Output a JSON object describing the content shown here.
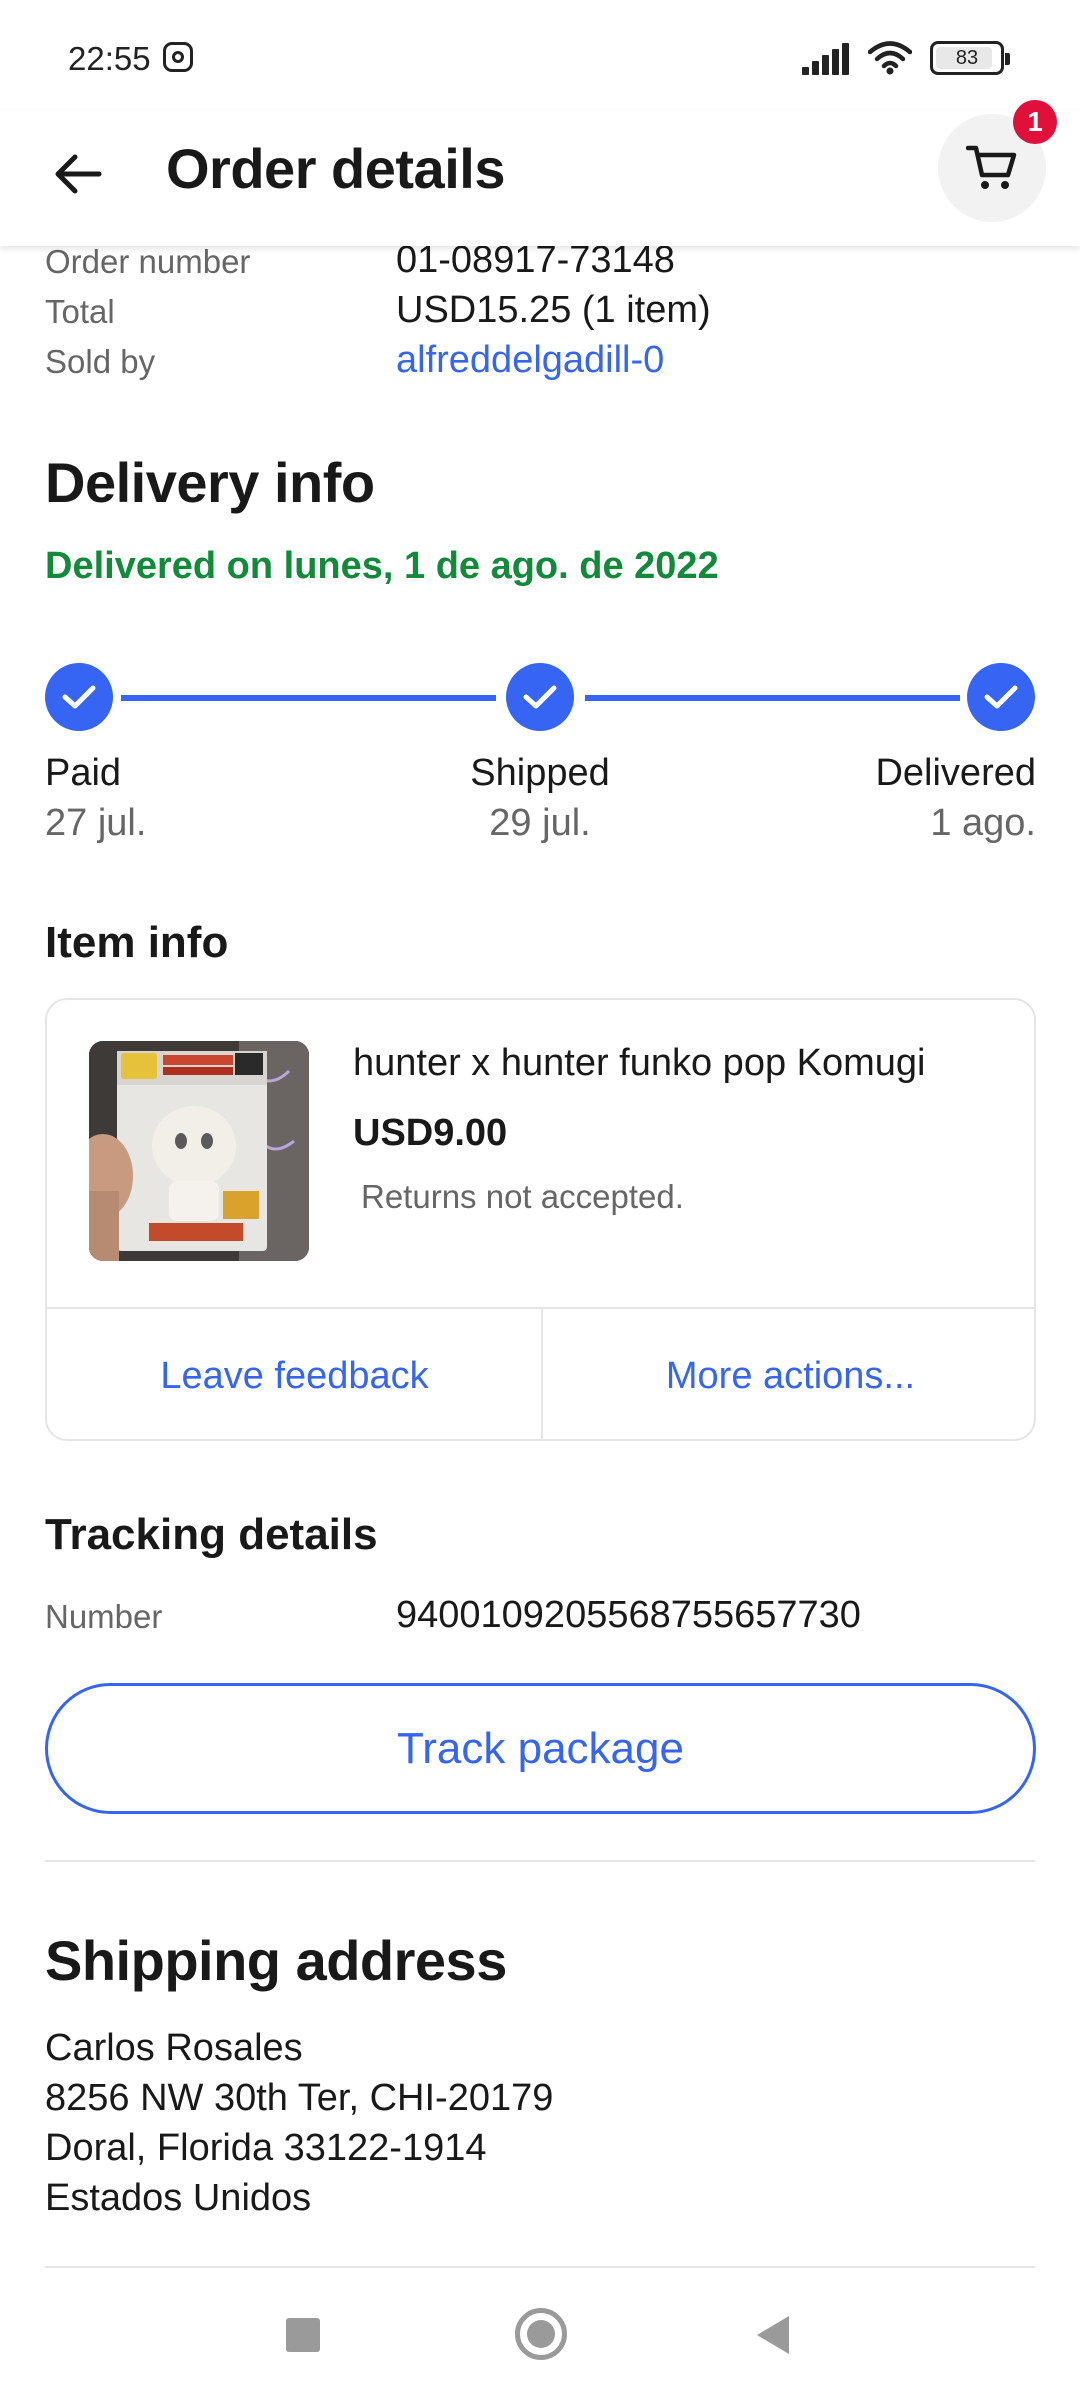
{
  "status_bar": {
    "time": "22:55",
    "battery": "83",
    "icons": [
      "instagram-icon",
      "signal-icon",
      "wifi-icon",
      "battery-icon"
    ]
  },
  "app_bar": {
    "title": "Order details",
    "back_icon": "arrow-left-icon",
    "cart_icon": "cart-icon",
    "cart_badge": "1"
  },
  "order_summary": {
    "order_number_label": "Order number",
    "order_number": "01-08917-73148",
    "total_label": "Total",
    "total": "USD15.25 (1 item)",
    "sold_by_label": "Sold by",
    "seller": "alfreddelgadill-0"
  },
  "delivery": {
    "title": "Delivery info",
    "status": "Delivered on lunes, 1 de ago. de 2022",
    "steps": [
      {
        "label": "Paid",
        "date": "27 jul."
      },
      {
        "label": "Shipped",
        "date": "29 jul."
      },
      {
        "label": "Delivered",
        "date": "1 ago."
      }
    ]
  },
  "item_info": {
    "title": "Item info",
    "item_title": "hunter x hunter funko pop Komugi",
    "price": "USD9.00",
    "returns": "Returns not accepted.",
    "leave_feedback": "Leave feedback",
    "more_actions": "More actions..."
  },
  "tracking": {
    "title": "Tracking details",
    "number_label": "Number",
    "number": "9400109205568755657730",
    "track_button": "Track package"
  },
  "shipping": {
    "title": "Shipping address",
    "lines": [
      "Carlos Rosales",
      "8256 NW 30th Ter, CHI-20179",
      "Doral, Florida 33122-1914",
      "Estados Unidos"
    ]
  },
  "colors": {
    "accent": "#3665f3",
    "success": "#118a3a",
    "badge": "#e0103a"
  }
}
